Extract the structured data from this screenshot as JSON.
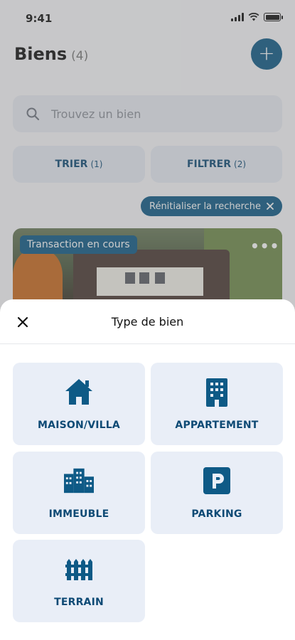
{
  "status": {
    "time": "9:41"
  },
  "header": {
    "title": "Biens",
    "count": "(4)",
    "add_label": "+"
  },
  "search": {
    "placeholder": "Trouvez un bien"
  },
  "toolbar": {
    "sort_label": "TRIER",
    "sort_count": "(1)",
    "filter_label": "FILTRER",
    "filter_count": "(2)",
    "reset_label": "Rénitialiser la recherche"
  },
  "card": {
    "badge": "Transaction en cours",
    "more": "•••"
  },
  "sheet": {
    "title": "Type de bien",
    "options": [
      {
        "label": "MAISON/VILLA",
        "icon": "house-icon"
      },
      {
        "label": "APPARTEMENT",
        "icon": "building-icon"
      },
      {
        "label": "IMMEUBLE",
        "icon": "city-buildings-icon"
      },
      {
        "label": "PARKING",
        "icon": "parking-icon"
      },
      {
        "label": "TERRAIN",
        "icon": "fence-icon"
      }
    ]
  },
  "colors": {
    "accent": "#0e5a86",
    "tile_bg": "#e9eef7",
    "tile_text": "#0e4a75"
  }
}
